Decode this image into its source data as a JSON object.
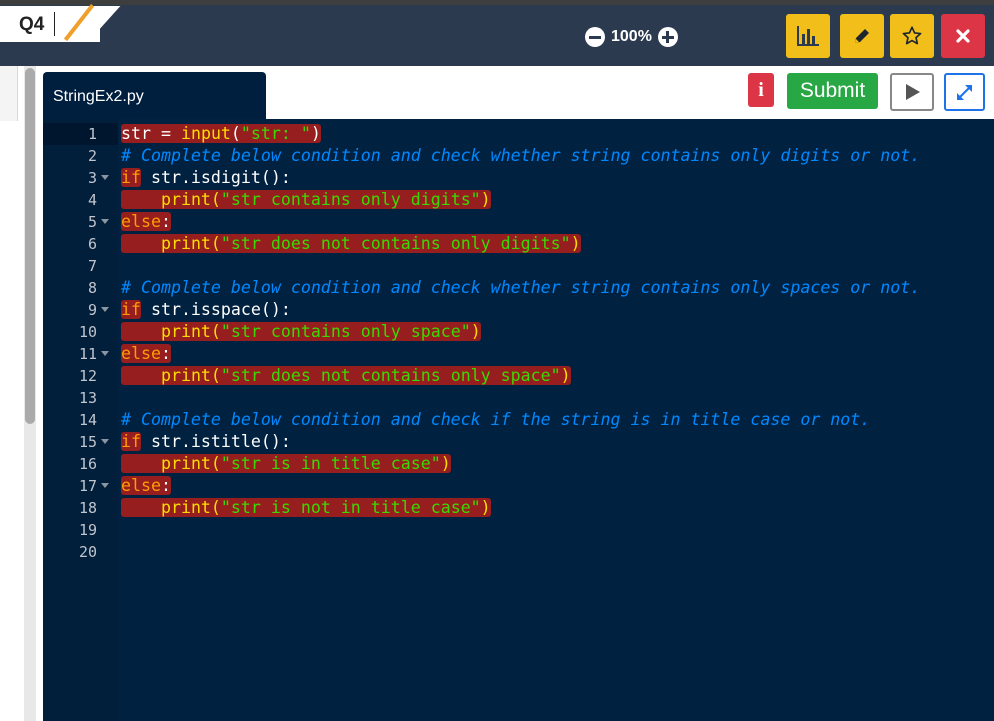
{
  "header": {
    "question_label": "Q4",
    "zoom_level": "100%"
  },
  "colors": {
    "top_bar": "#2b3a4f",
    "editor_bg": "#002240",
    "submit": "#28a745",
    "danger": "#dc3545",
    "warning": "#f2be1a",
    "highlight": "#961e1e"
  },
  "toolbar": {
    "icons": [
      "bar-chart-icon",
      "pencil-icon",
      "star-icon",
      "close-icon"
    ]
  },
  "file": {
    "name": "StringEx2.py"
  },
  "actions": {
    "info_label": "i",
    "submit_label": "Submit"
  },
  "editor": {
    "lines": [
      {
        "num": "1"
      },
      {
        "num": "2"
      },
      {
        "num": "3"
      },
      {
        "num": "4"
      },
      {
        "num": "5"
      },
      {
        "num": "6"
      },
      {
        "num": "7"
      },
      {
        "num": "8"
      },
      {
        "num": "9"
      },
      {
        "num": "10"
      },
      {
        "num": "11"
      },
      {
        "num": "12"
      },
      {
        "num": "13"
      },
      {
        "num": "14"
      },
      {
        "num": "15"
      },
      {
        "num": "16"
      },
      {
        "num": "17"
      },
      {
        "num": "18"
      },
      {
        "num": "19"
      },
      {
        "num": "20"
      }
    ],
    "code": {
      "l1_var": "str",
      "l1_eq": " = ",
      "l1_fn": "input",
      "l1_open": "(",
      "l1_str": "\"str: \"",
      "l1_close": ")",
      "l2_comment": "# Complete below condition and check whether string contains only digits or not.",
      "l3_kw": "if",
      "l3_rest": " str.isdigit():",
      "l4_indent": "    ",
      "l4_fn": "print(",
      "l4_str": "\"str contains only digits\"",
      "l4_close": ")",
      "l5_kw": "else",
      "l5_colon": ":",
      "l6_indent": "    ",
      "l6_fn": "print(",
      "l6_str": "\"str does not contains only digits\"",
      "l6_close": ")",
      "l8_comment": "# Complete below condition and check whether string contains only spaces or not.",
      "l9_kw": "if",
      "l9_rest": " str.isspace():",
      "l10_indent": "    ",
      "l10_fn": "print(",
      "l10_str": "\"str contains only space\"",
      "l10_close": ")",
      "l11_kw": "else",
      "l11_colon": ":",
      "l12_indent": "    ",
      "l12_fn": "print(",
      "l12_str": "\"str does not contains only space\"",
      "l12_close": ")",
      "l14_comment": "# Complete below condition and check if the string is in title case or not.",
      "l15_kw": "if",
      "l15_rest": " str.istitle():",
      "l16_indent": "    ",
      "l16_fn": "print(",
      "l16_str": "\"str is in title case\"",
      "l16_close": ")",
      "l17_kw": "else",
      "l17_colon": ":",
      "l18_indent": "    ",
      "l18_fn": "print(",
      "l18_str": "\"str is not in title case\"",
      "l18_close": ")"
    }
  }
}
